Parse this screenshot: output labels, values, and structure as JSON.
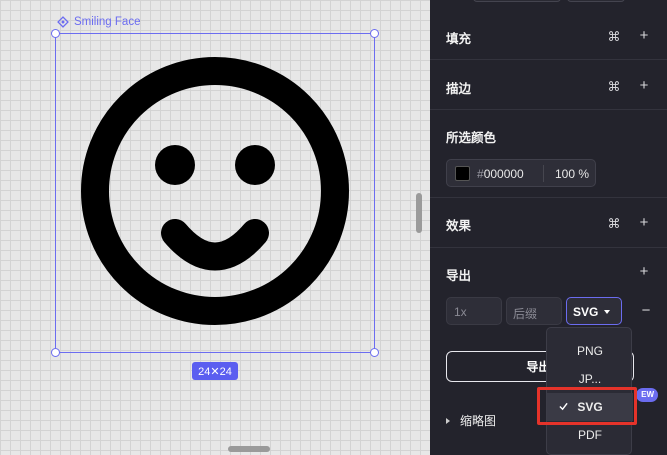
{
  "canvas": {
    "frame_label": "Smiling Face",
    "size_badge": "24✕24"
  },
  "panel": {
    "fill": {
      "title": "填充"
    },
    "stroke": {
      "title": "描边"
    },
    "selection_colors": {
      "title": "所选颜色",
      "hex": "000000",
      "hex_prefix": "#",
      "opacity": "100 %",
      "swatch_color": "#000000"
    },
    "effects": {
      "title": "效果"
    },
    "export": {
      "title": "导出",
      "scale_placeholder": "1x",
      "suffix_placeholder": "后缀",
      "format": "SVG",
      "button_label": "导出i",
      "new_badge": "EW",
      "format_options": [
        "PNG",
        "JP...",
        "SVG",
        "PDF"
      ],
      "selected_option": "SVG"
    },
    "thumbnail": {
      "title": "缩略图"
    }
  },
  "colors": {
    "accent": "#6b6cf0",
    "panel_bg": "#23232c",
    "highlight": "#e5332a"
  }
}
